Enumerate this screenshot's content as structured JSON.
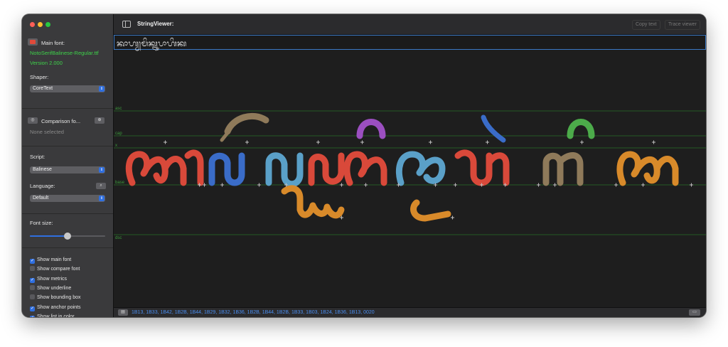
{
  "sidebar": {
    "main_font_label": "Main font:",
    "font_file": "NotoSerifBalinese-Regular.ttf",
    "font_version": "Version 2.000",
    "shaper_label": "Shaper:",
    "shaper_value": "CoreText",
    "comparison_label": "Comparison fo...",
    "comparison_value": "None selected",
    "script_label": "Script:",
    "script_value": "Balinese",
    "language_label": "Language:",
    "language_value": "Default",
    "font_size_label": "Font size:",
    "font_size_level": 0.5,
    "checkboxes": [
      {
        "label": "Show main font",
        "checked": true
      },
      {
        "label": "Show compare font",
        "checked": false
      },
      {
        "label": "Show metrics",
        "checked": true
      },
      {
        "label": "Show underline",
        "checked": false
      },
      {
        "label": "Show bounding box",
        "checked": false
      },
      {
        "label": "Show anchor points",
        "checked": true
      },
      {
        "label": "Show list in color",
        "checked": true
      }
    ]
  },
  "header": {
    "title": "StringViewer:",
    "copy_text": "Copy text",
    "trace_viewer": "Trace viewer"
  },
  "input": {
    "value": "ᬓᬵᬳ᭄ᬬᬫᬶᬓ᭄ᬦᬸᬧᬵᬳᬶᬓ"
  },
  "metrics": {
    "asc": "asc",
    "cap": "cap",
    "x": "x",
    "base": "base",
    "dsc": "dsc"
  },
  "status": {
    "codepoints": "1B13, 1B33, 1B42, 1B2B, 1B44, 1B29, 1B32, 1B36, 1B2B, 1B44, 1B2B, 1B33, 1B03, 1B24, 1B36, 1B13, 0020"
  },
  "colors": {
    "accent": "#2f6fe0",
    "metric_line": "#3c9a3c",
    "status_text": "#4a8ef0",
    "glyph_red": "#d9493a",
    "glyph_blue": "#3a6cc8",
    "glyph_green": "#4cab4a",
    "glyph_purple": "#9b4fc0",
    "glyph_teal": "#5aa0c8",
    "glyph_orange": "#d88a2a",
    "glyph_brown": "#8f7a5a"
  }
}
